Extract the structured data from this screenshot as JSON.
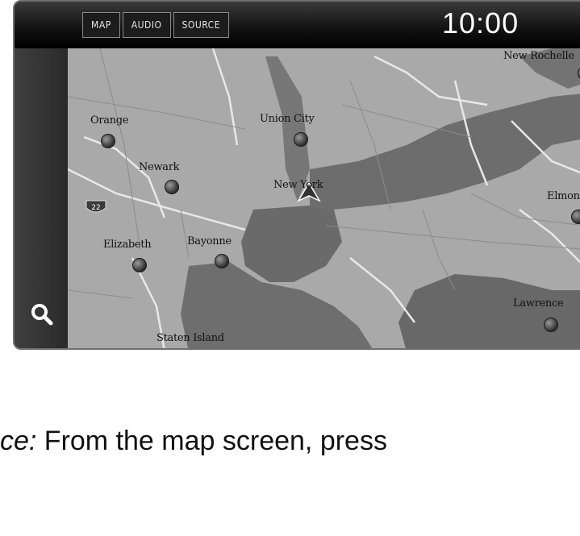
{
  "topbar": {
    "tabs": [
      {
        "label": "MAP"
      },
      {
        "label": "AUDIO"
      },
      {
        "label": "SOURCE"
      }
    ],
    "clock": "10:00"
  },
  "sidebar": {
    "search_icon": "search-icon"
  },
  "map": {
    "places": [
      {
        "name": "Orange"
      },
      {
        "name": "Union City"
      },
      {
        "name": "Newark"
      },
      {
        "name": "New York"
      },
      {
        "name": "Elizabeth"
      },
      {
        "name": "Bayonne"
      },
      {
        "name": "Staten Island"
      },
      {
        "name": "Elmont"
      },
      {
        "name": "Lawrence"
      },
      {
        "name": "New Rochelle"
      }
    ],
    "route_shield": "22"
  },
  "caption": {
    "italic_part": "ce:",
    "text_part": " From the map screen, press"
  }
}
